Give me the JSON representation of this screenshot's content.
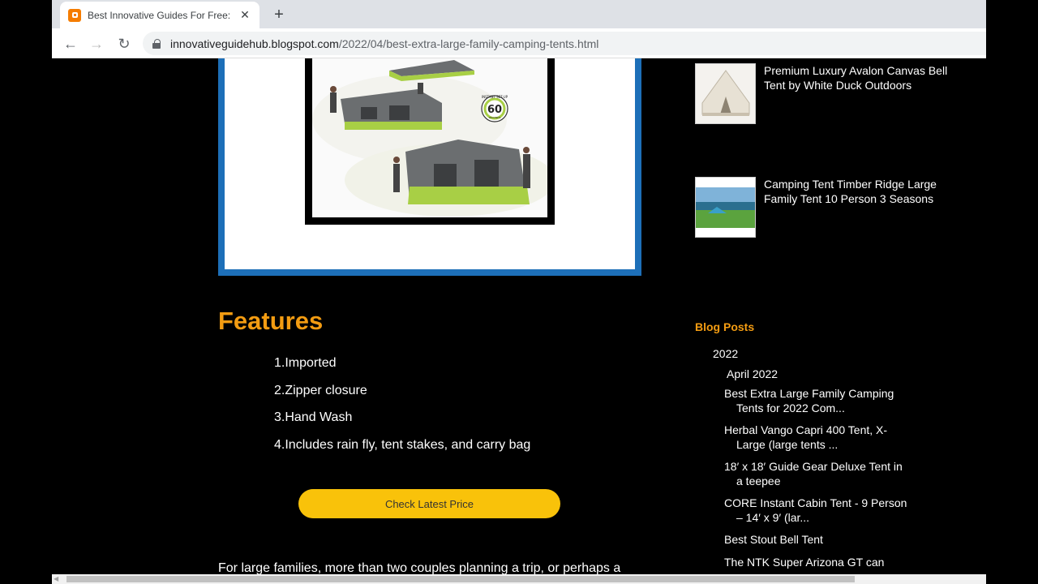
{
  "browser": {
    "tab_title": "Best Innovative Guides For Free: ",
    "url_domain": "innovativeguidehub.blogspot.com",
    "url_path": "/2022/04/best-extra-large-family-camping-tents.html"
  },
  "main": {
    "features_title": "Features",
    "features": [
      "1.Imported",
      "2.Zipper closure",
      "3.Hand Wash",
      "4.Includes rain fly, tent stakes, and carry bag"
    ],
    "cta_label": "Check Latest Price",
    "body_text": "For large families, more than two couples planning a trip, or perhaps a",
    "product_badge": "60",
    "product_badge_top": "INSTANT SET-UP",
    "product_badge_bottom": "SECONDS"
  },
  "sidebar": {
    "related": [
      {
        "title": "Premium Luxury Avalon Canvas Bell Tent by White Duck Outdoors"
      },
      {
        "title": "Camping Tent Timber Ridge Large Family Tent 10 Person 3 Seasons"
      }
    ],
    "blog_heading": "Blog Posts",
    "year": "2022",
    "month": "April 2022",
    "posts": [
      "Best Extra Large Family Camping Tents for 2022 Com...",
      "Herbal Vango Capri 400 Tent, X-Large (large tents ...",
      "18′ x 18′ Guide Gear Deluxe Tent in a teepee",
      "CORE Instant Cabin Tent - 9 Person – 14′ x 9′ (lar...",
      "Best Stout Bell Tent",
      "The NTK Super Arizona GT can"
    ]
  },
  "colors": {
    "accent": "#f39c12",
    "cta": "#f9c20a",
    "frame": "#1d6fb8",
    "tent_green": "#a8cf45"
  }
}
